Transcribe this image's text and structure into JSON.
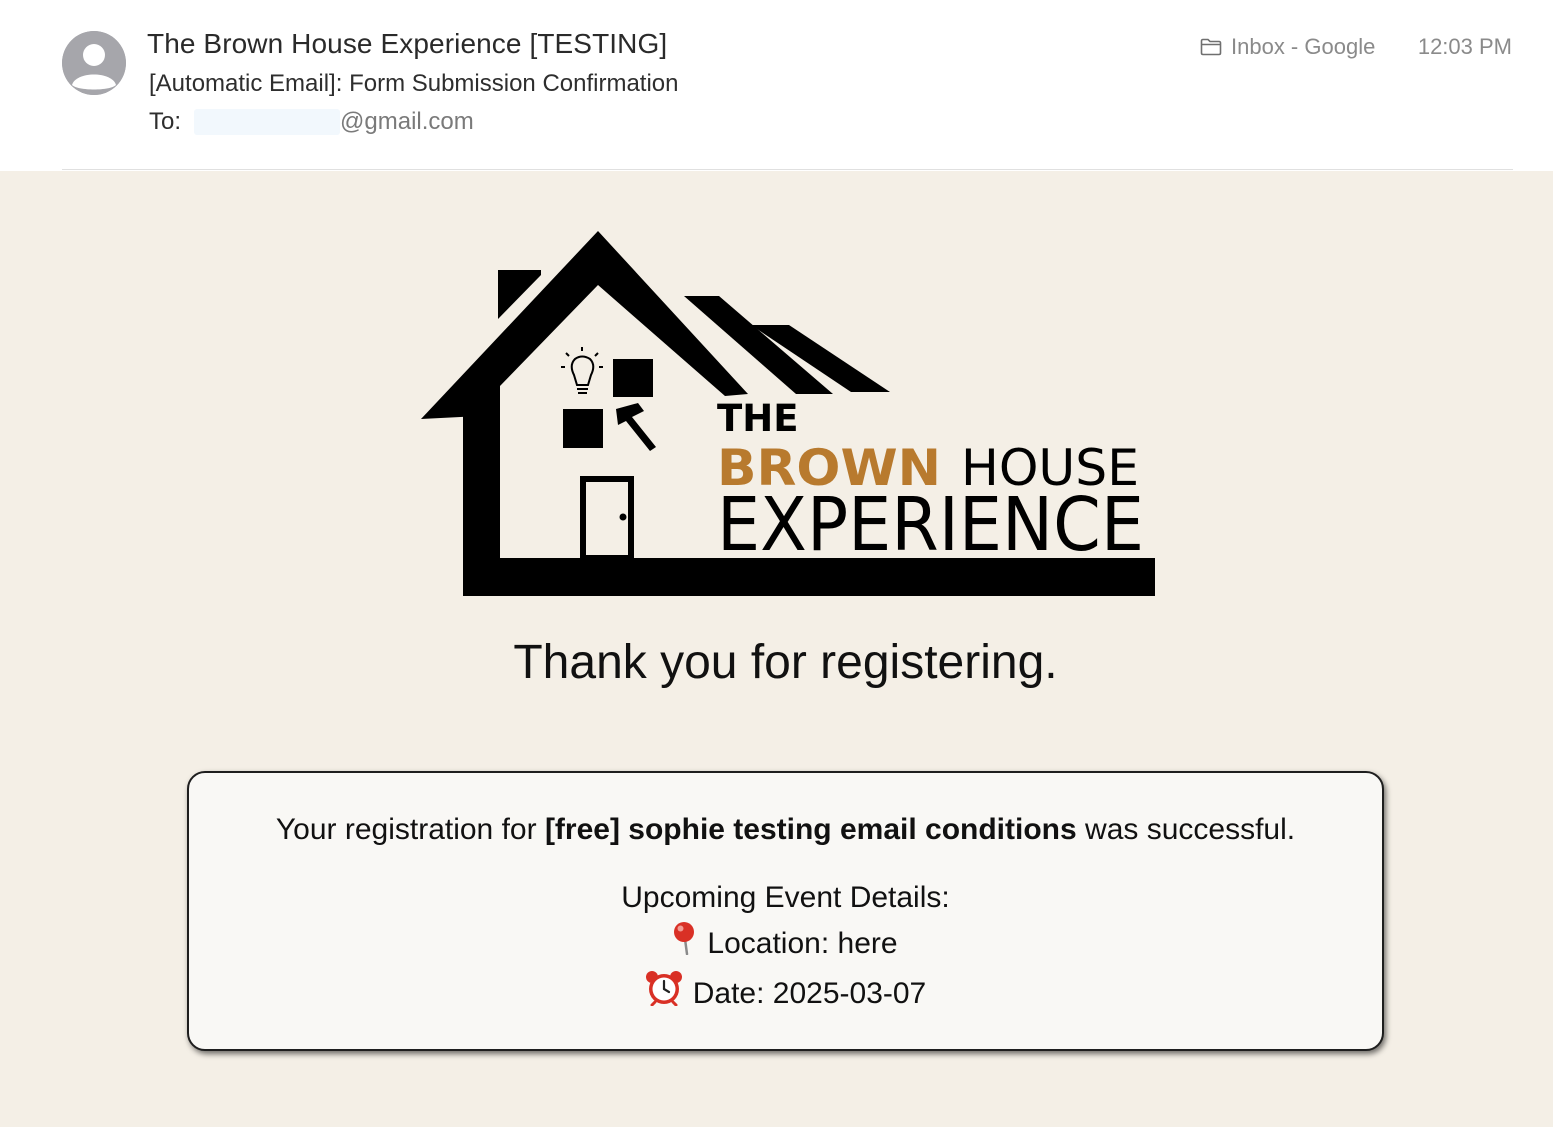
{
  "header": {
    "sender": "The Brown House Experience [TESTING]",
    "subject": "[Automatic Email]: Form Submission Confirmation",
    "to_label": "To:",
    "to_domain": "@gmail.com",
    "mailbox": "Inbox - Google",
    "time": "12:03 PM"
  },
  "logo": {
    "line1": "THE",
    "line2a": "BROWN",
    "line2b": "HOUSE",
    "line3": "EXPERIENCE",
    "accent_color": "#b87a2e"
  },
  "body": {
    "thank_you": "Thank you for registering.",
    "reg_prefix": "Your registration for ",
    "event_name": "[free] sophie testing email conditions",
    "reg_suffix": " was successful.",
    "details_heading": "Upcoming Event Details:",
    "location": "Location: here",
    "date": "Date: 2025-03-07",
    "location_icon": "pin-icon",
    "date_icon": "alarm-clock-icon"
  }
}
